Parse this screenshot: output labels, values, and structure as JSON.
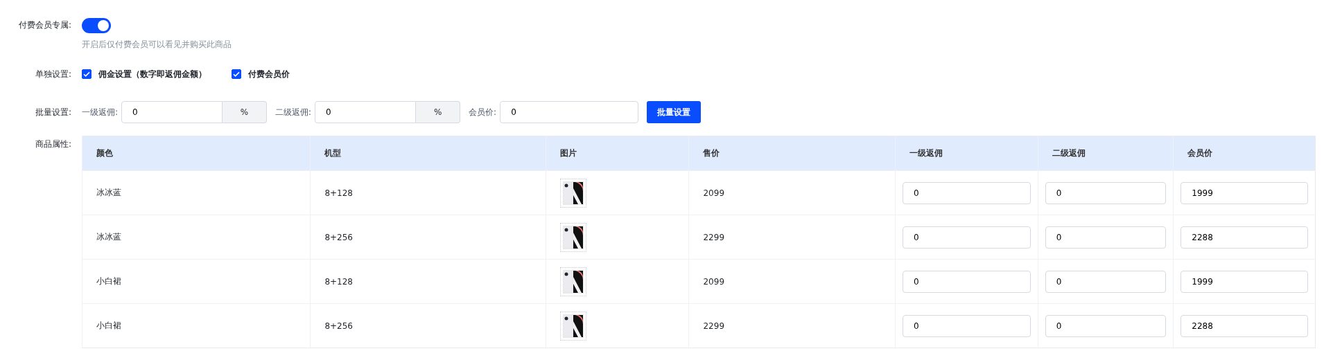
{
  "member_only": {
    "label": "付费会员专属:",
    "on": true,
    "hint": "开启后仅付费会员可以看见并购买此商品"
  },
  "individual": {
    "label": "单独设置:",
    "options": [
      {
        "label": "佣金设置（数字即返佣金额）",
        "checked": true
      },
      {
        "label": "付费会员价",
        "checked": true
      }
    ]
  },
  "batch": {
    "label": "批量设置:",
    "fields": [
      {
        "label": "一级返佣:",
        "value": "0",
        "suffix": "%"
      },
      {
        "label": "二级返佣:",
        "value": "0",
        "suffix": "%"
      },
      {
        "label": "会员价:",
        "value": "0"
      }
    ],
    "button": "批量设置"
  },
  "attributes": {
    "label": "商品属性:",
    "columns": [
      "颜色",
      "机型",
      "图片",
      "售价",
      "一级返佣",
      "二级返佣",
      "会员价"
    ],
    "rows": [
      {
        "variant": "冰冰蓝",
        "model": "8+128",
        "price": "2099",
        "level1": "0",
        "level2": "0",
        "member_price": "1999"
      },
      {
        "variant": "冰冰蓝",
        "model": "8+256",
        "price": "2299",
        "level1": "0",
        "level2": "0",
        "member_price": "2288"
      },
      {
        "variant": "小白裙",
        "model": "8+128",
        "price": "2099",
        "level1": "0",
        "level2": "0",
        "member_price": "1999"
      },
      {
        "variant": "小白裙",
        "model": "8+256",
        "price": "2299",
        "level1": "0",
        "level2": "0",
        "member_price": "2288"
      }
    ]
  }
}
